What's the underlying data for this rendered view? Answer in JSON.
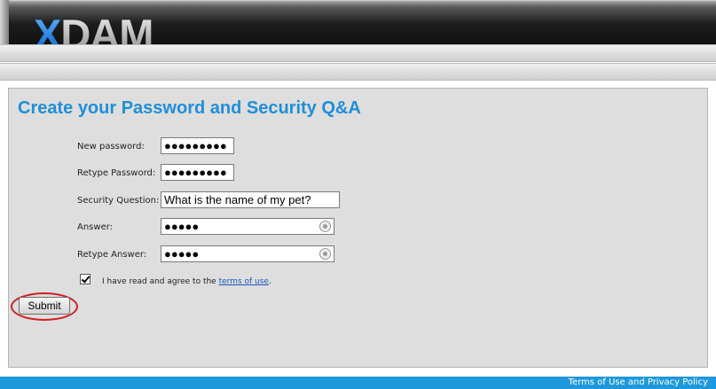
{
  "header": {
    "logo_part1": "X",
    "logo_part2": "DAM"
  },
  "form": {
    "title": "Create your Password and Security Q&A",
    "new_password": {
      "label": "New password:",
      "value": "●●●●●●●●●"
    },
    "retype_password": {
      "label": "Retype Password:",
      "value": "●●●●●●●●●"
    },
    "security_question": {
      "label": "Security Question:",
      "value": "What is the name of my pet?"
    },
    "answer": {
      "label": "Answer:",
      "value": "●●●●●"
    },
    "retype_answer": {
      "label": "Retype Answer:",
      "value": "●●●●●"
    },
    "agree_text": "I have read and agree to the ",
    "terms_link": "terms of use",
    "agree_suffix": ".",
    "agree_checked": true,
    "submit_label": "Submit"
  },
  "footer": {
    "link": "Terms of Use and Privacy Policy"
  },
  "colors": {
    "accent": "#1f8ed8",
    "footer": "#1e98dc",
    "highlight_ring": "#d01f1f"
  }
}
